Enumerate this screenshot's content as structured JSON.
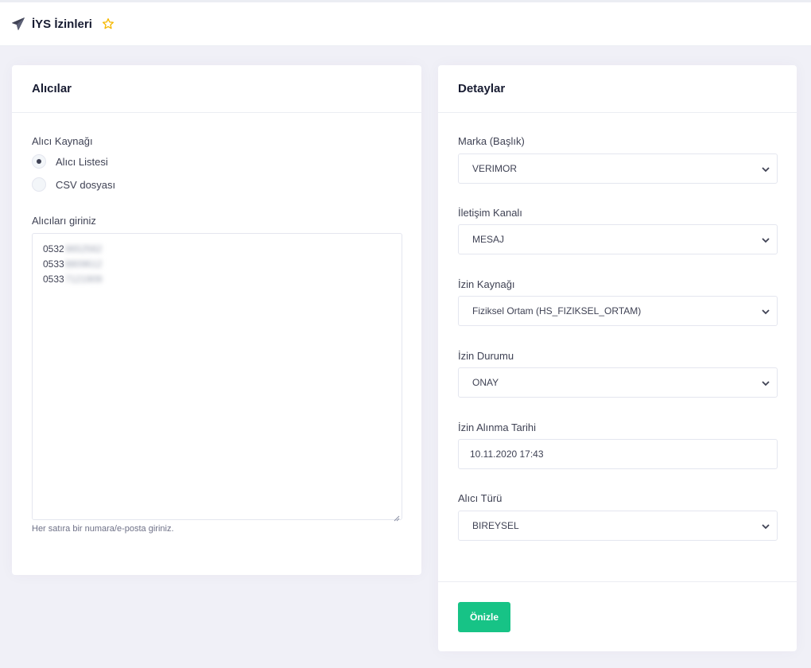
{
  "header": {
    "title": "İYS İzinleri",
    "icon": "paper-plane-icon",
    "favorite_icon": "star-outline-icon",
    "accent_color": "#f5b800"
  },
  "left_card": {
    "title": "Alıcılar",
    "source_label": "Alıcı Kaynağı",
    "radio_options": [
      {
        "label": "Alıcı Listesi",
        "selected": true
      },
      {
        "label": "CSV dosyası",
        "selected": false
      }
    ],
    "recipients_label": "Alıcıları giriniz",
    "recipients": [
      {
        "prefix": "0532",
        "hidden": "9652562"
      },
      {
        "prefix": "0533",
        "hidden": "8809612"
      },
      {
        "prefix": "0533",
        "hidden": "7121909"
      }
    ],
    "hint": "Her satıra bir numara/e-posta giriniz."
  },
  "right_card": {
    "title": "Detaylar",
    "fields": {
      "brand": {
        "label": "Marka (Başlık)",
        "value": "VERIMOR"
      },
      "channel": {
        "label": "İletişim Kanalı",
        "value": "MESAJ"
      },
      "permission_source": {
        "label": "İzin Kaynağı",
        "value": "Fiziksel Ortam (HS_FIZIKSEL_ORTAM)"
      },
      "permission_status": {
        "label": "İzin Durumu",
        "value": "ONAY"
      },
      "permission_date": {
        "label": "İzin Alınma Tarihi",
        "value": "10.11.2020 17:43"
      },
      "recipient_type": {
        "label": "Alıcı Türü",
        "value": "BIREYSEL"
      }
    },
    "preview_button": "Önizle",
    "button_color": "#17c386"
  }
}
